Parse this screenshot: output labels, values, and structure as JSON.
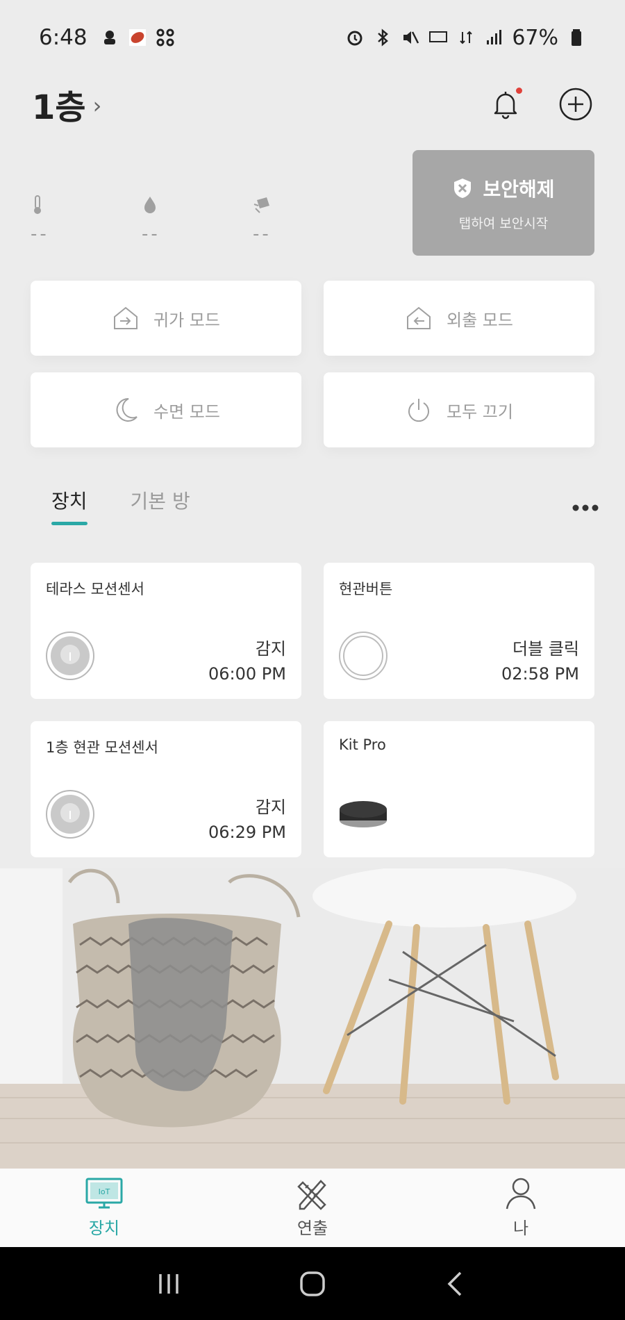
{
  "status_bar": {
    "time": "6:48",
    "battery": "67%"
  },
  "header": {
    "title": "1층",
    "chevron": "›"
  },
  "sensors": [
    {
      "icon": "thermometer-icon",
      "value": "--"
    },
    {
      "icon": "humidity-icon",
      "value": "--"
    },
    {
      "icon": "light-icon",
      "value": "--"
    }
  ],
  "security": {
    "title": "보안해제",
    "subtitle": "탭하여 보안시작"
  },
  "modes": [
    {
      "label": "귀가 모드",
      "icon": "home-in-icon"
    },
    {
      "label": "외출 모드",
      "icon": "home-out-icon"
    },
    {
      "label": "수면 모드",
      "icon": "moon-icon"
    },
    {
      "label": "모두 끄기",
      "icon": "power-icon"
    }
  ],
  "tabs": [
    {
      "label": "장치",
      "active": true
    },
    {
      "label": "기본 방",
      "active": false
    }
  ],
  "devices": [
    {
      "name": "테라스 모션센서",
      "status_1": "감지",
      "status_2": "06:00 PM",
      "icon": "motion-sensor-icon"
    },
    {
      "name": "현관버튼",
      "status_1": "더블 클릭",
      "status_2": "02:58 PM",
      "icon": "button-icon"
    },
    {
      "name": "1층 현관 모션센서",
      "status_1": "감지",
      "status_2": "06:29 PM",
      "icon": "motion-sensor-icon"
    },
    {
      "name": "Kit Pro",
      "status_1": "",
      "status_2": "",
      "icon": "hub-icon"
    }
  ],
  "bottom_nav": [
    {
      "label": "장치",
      "icon": "iot-icon",
      "active": true
    },
    {
      "label": "연출",
      "icon": "pencil-ruler-icon",
      "active": false
    },
    {
      "label": "나",
      "icon": "person-icon",
      "active": false
    }
  ],
  "accent_color": "#2aa8a6",
  "security_color": "#a7a7a7"
}
